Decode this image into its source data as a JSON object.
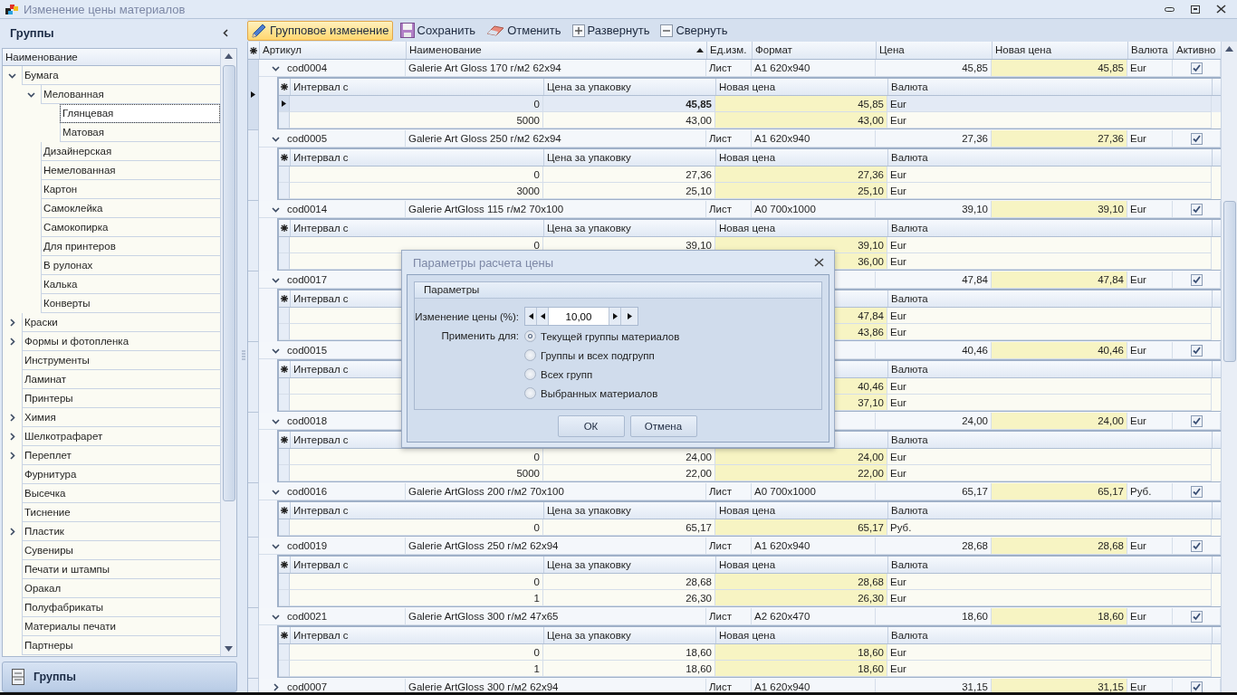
{
  "window": {
    "title": "Изменение цены материалов"
  },
  "left_panel": {
    "title": "Группы",
    "tree_header": "Наименование",
    "nav_button": "Группы"
  },
  "tree": {
    "items": [
      {
        "label": "Бумага",
        "expanded": true,
        "selected": false,
        "children": [
          {
            "label": "Мелованная",
            "expanded": true,
            "selected": false,
            "children": [
              {
                "label": "Глянцевая",
                "selected": true
              },
              {
                "label": "Матовая",
                "selected": false
              }
            ]
          },
          {
            "label": "Дизайнерская",
            "selected": false
          },
          {
            "label": "Немелованная",
            "selected": false
          },
          {
            "label": "Картон",
            "selected": false
          },
          {
            "label": "Самоклейка",
            "selected": false
          },
          {
            "label": "Самокопирка",
            "selected": false
          },
          {
            "label": "Для принтеров",
            "selected": false
          },
          {
            "label": "В рулонах",
            "selected": false
          },
          {
            "label": "Калька",
            "selected": false
          },
          {
            "label": "Конверты",
            "selected": false
          }
        ]
      },
      {
        "label": "Краски",
        "expanded": false,
        "selected": false
      },
      {
        "label": "Формы и фотопленка",
        "expanded": false,
        "selected": false
      },
      {
        "label": "Инструменты",
        "selected": false
      },
      {
        "label": "Ламинат",
        "selected": false
      },
      {
        "label": "Принтеры",
        "selected": false
      },
      {
        "label": "Химия",
        "expanded": false,
        "selected": false
      },
      {
        "label": "Шелкотрафарет",
        "expanded": false,
        "selected": false
      },
      {
        "label": "Переплет",
        "expanded": false,
        "selected": false
      },
      {
        "label": "Фурнитура",
        "selected": false
      },
      {
        "label": "Высечка",
        "selected": false
      },
      {
        "label": "Тиснение",
        "selected": false
      },
      {
        "label": "Пластик",
        "expanded": false,
        "selected": false
      },
      {
        "label": "Сувениры",
        "selected": false
      },
      {
        "label": "Печати и штампы",
        "selected": false
      },
      {
        "label": "Оракал",
        "selected": false
      },
      {
        "label": "Полуфабрикаты",
        "selected": false
      },
      {
        "label": "Материалы печати",
        "selected": false
      },
      {
        "label": "Партнеры",
        "selected": false
      }
    ]
  },
  "toolbar": [
    {
      "kind": "pencil",
      "label": "Групповое изменение",
      "highlighted": true
    },
    {
      "kind": "save",
      "label": "Сохранить",
      "highlighted": false
    },
    {
      "kind": "eraser",
      "label": "Отменить",
      "highlighted": false
    },
    {
      "kind": "plus",
      "label": "Развернуть",
      "highlighted": false
    },
    {
      "kind": "minus",
      "label": "Свернуть",
      "highlighted": false
    }
  ],
  "grid": {
    "columns": [
      {
        "label": "Артикул",
        "sorted": false
      },
      {
        "label": "Наименование",
        "sorted": true
      },
      {
        "label": "Ед.изм.",
        "sorted": false
      },
      {
        "label": "Формат",
        "sorted": false
      },
      {
        "label": "Цена",
        "sorted": false
      },
      {
        "label": "Новая цена",
        "sorted": false
      },
      {
        "label": "Валюта",
        "sorted": false
      },
      {
        "label": "Активно",
        "sorted": false
      }
    ]
  },
  "groups": [
    {
      "selected": true,
      "article": "cod0004",
      "name": "Galerie Art Gloss 170 г/м2 62x94",
      "unit": "Лист",
      "format": "A1 620x940",
      "price": "45,85",
      "new_price": "45,85",
      "currency": "Eur",
      "active": true,
      "sub_header": {
        "from": "Интервал с",
        "pack_price": "Цена за упаковку",
        "new_price": "Новая цена",
        "currency": "Валюта"
      },
      "sub_rows": [
        {
          "selected": true,
          "from": "0",
          "pack_price": "45,85",
          "new_price": "45,85",
          "currency": "Eur"
        },
        {
          "selected": false,
          "from": "5000",
          "pack_price": "43,00",
          "new_price": "43,00",
          "currency": "Eur"
        }
      ]
    },
    {
      "selected": false,
      "article": "cod0005",
      "name": "Galerie Art Gloss 250 г/м2 62x94",
      "unit": "Лист",
      "format": "A1 620x940",
      "price": "27,36",
      "new_price": "27,36",
      "currency": "Eur",
      "active": true,
      "sub_header": {
        "from": "Интервал с",
        "pack_price": "Цена за упаковку",
        "new_price": "Новая цена",
        "currency": "Валюта"
      },
      "sub_rows": [
        {
          "selected": false,
          "from": "0",
          "pack_price": "27,36",
          "new_price": "27,36",
          "currency": "Eur"
        },
        {
          "selected": false,
          "from": "3000",
          "pack_price": "25,10",
          "new_price": "25,10",
          "currency": "Eur"
        }
      ]
    },
    {
      "selected": false,
      "article": "cod0014",
      "name": "Galerie ArtGloss 115 г/м2 70x100",
      "unit": "Лист",
      "format": "A0 700x1000",
      "price": "39,10",
      "new_price": "39,10",
      "currency": "Eur",
      "active": true,
      "sub_header": {
        "from": "Интервал с",
        "pack_price": "Цена за упаковку",
        "new_price": "Новая цена",
        "currency": "Валюта"
      },
      "sub_rows": [
        {
          "selected": false,
          "from": "0",
          "pack_price": "39,10",
          "new_price": "39,10",
          "currency": "Eur"
        },
        {
          "selected": false,
          "new_price": "36,00",
          "currency": "Eur"
        }
      ]
    },
    {
      "selected": false,
      "article": "cod0017",
      "price": "47,84",
      "new_price": "47,84",
      "currency": "Eur",
      "active": true,
      "sub_header": {
        "from": "Интервал с",
        "currency": "Валюта"
      },
      "sub_rows": [
        {
          "selected": false,
          "new_price": "47,84",
          "currency": "Eur"
        },
        {
          "selected": false,
          "new_price": "43,86",
          "currency": "Eur"
        }
      ]
    },
    {
      "selected": false,
      "article": "cod0015",
      "price": "40,46",
      "new_price": "40,46",
      "currency": "Eur",
      "active": true,
      "sub_header": {
        "from": "Интервал с",
        "currency": "Валюта"
      },
      "sub_rows": [
        {
          "selected": false,
          "new_price": "40,46",
          "currency": "Eur"
        },
        {
          "selected": false,
          "new_price": "37,10",
          "currency": "Eur"
        }
      ]
    },
    {
      "selected": false,
      "article": "cod0018",
      "price": "24,00",
      "new_price": "24,00",
      "currency": "Eur",
      "active": true,
      "sub_header": {
        "from": "Интервал с",
        "currency": "Валюта"
      },
      "sub_rows": [
        {
          "selected": false,
          "from": "0",
          "pack_price": "24,00",
          "new_price": "24,00",
          "currency": "Eur"
        },
        {
          "selected": false,
          "from": "5000",
          "pack_price": "22,00",
          "new_price": "22,00",
          "currency": "Eur"
        }
      ]
    },
    {
      "selected": false,
      "article": "cod0016",
      "name": "Galerie ArtGloss 200 г/м2 70x100",
      "unit": "Лист",
      "format": "A0 700x1000",
      "price": "65,17",
      "new_price": "65,17",
      "currency": "Руб.",
      "active": true,
      "sub_header": {
        "from": "Интервал с",
        "pack_price": "Цена за упаковку",
        "new_price": "Новая цена",
        "currency": "Валюта"
      },
      "sub_rows": [
        {
          "selected": false,
          "from": "0",
          "pack_price": "65,17",
          "new_price": "65,17",
          "currency": "Руб."
        }
      ]
    },
    {
      "selected": false,
      "article": "cod0019",
      "name": "Galerie ArtGloss 250 г/м2 62x94",
      "unit": "Лист",
      "format": "A1 620x940",
      "price": "28,68",
      "new_price": "28,68",
      "currency": "Eur",
      "active": true,
      "sub_header": {
        "from": "Интервал с",
        "pack_price": "Цена за упаковку",
        "new_price": "Новая цена",
        "currency": "Валюта"
      },
      "sub_rows": [
        {
          "selected": false,
          "from": "0",
          "pack_price": "28,68",
          "new_price": "28,68",
          "currency": "Eur"
        },
        {
          "selected": false,
          "from": "1",
          "pack_price": "26,30",
          "new_price": "26,30",
          "currency": "Eur"
        }
      ]
    },
    {
      "selected": false,
      "article": "cod0021",
      "name": "Galerie ArtGloss 300 г/м2 47x65",
      "unit": "Лист",
      "format": "A2 620x470",
      "price": "18,60",
      "new_price": "18,60",
      "currency": "Eur",
      "active": true,
      "sub_header": {
        "from": "Интервал с",
        "pack_price": "Цена за упаковку",
        "new_price": "Новая цена",
        "currency": "Валюта"
      },
      "sub_rows": [
        {
          "selected": false,
          "from": "0",
          "pack_price": "18,60",
          "new_price": "18,60",
          "currency": "Eur"
        },
        {
          "selected": false,
          "from": "1",
          "pack_price": "18,60",
          "new_price": "18,60",
          "currency": "Eur"
        }
      ]
    },
    {
      "selected": false,
      "article": "cod0007",
      "name": "Galerie ArtGloss 300 г/м2 62x94",
      "unit": "Лист",
      "format": "A1 620x940",
      "price": "31,15",
      "new_price": "31,15",
      "currency": "Eur",
      "active": true
    }
  ],
  "dialog": {
    "title": "Параметры расчета цены",
    "group_title": "Параметры",
    "change_label": "Изменение цены (%):",
    "change_value": "10,00",
    "apply_label": "Применить для:",
    "apply_options": [
      {
        "label": "Текущей группы материалов",
        "selected": true
      },
      {
        "label": "Группы и всех подгрупп",
        "selected": false
      },
      {
        "label": "Всех групп",
        "selected": false
      },
      {
        "label": "Выбранных материалов",
        "selected": false
      }
    ],
    "buttons": [
      "ОК",
      "Отмена"
    ]
  }
}
